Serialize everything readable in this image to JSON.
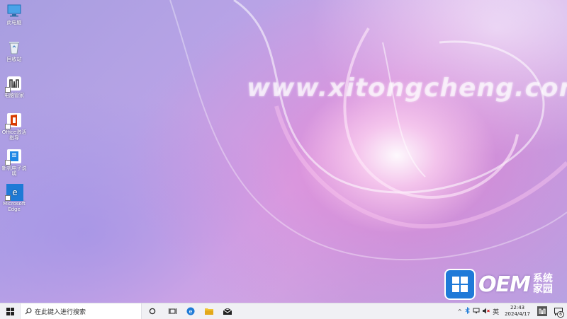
{
  "desktop": {
    "watermark": "www.xitongcheng.com",
    "icons": [
      {
        "label": "此电脑",
        "icon": "computer-icon"
      },
      {
        "label": "回收站",
        "icon": "recycle-bin-icon"
      },
      {
        "label": "电脑管家",
        "icon": "pc-manager-icon"
      },
      {
        "label": "Office激活指导",
        "icon": "office-icon"
      },
      {
        "label": "新机电子说明",
        "icon": "manual-icon"
      },
      {
        "label": "Microsoft Edge",
        "icon": "edge-icon"
      }
    ],
    "brand": {
      "text": "OEM",
      "cn_line1": "系统",
      "cn_line2": "家园",
      "color": "#1f7ad8"
    }
  },
  "taskbar": {
    "search_placeholder": "在此键入进行搜索",
    "ime": "英",
    "time": "22:43",
    "date": "2024/4/17",
    "notification_count": "6",
    "colors": {
      "bg": "#f0f0f4",
      "edge": "#1e7ad6",
      "folder": "#f1c232"
    }
  }
}
